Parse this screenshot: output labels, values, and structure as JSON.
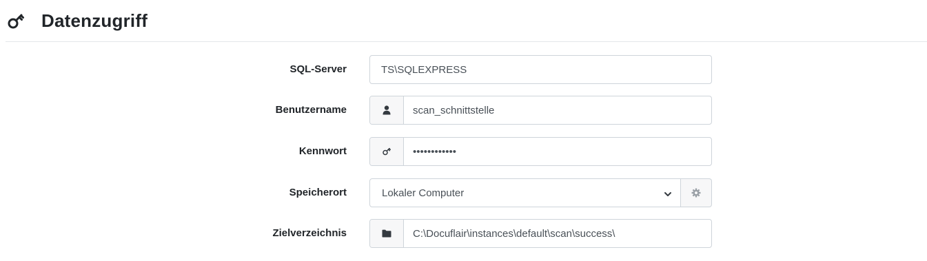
{
  "header": {
    "title": "Datenzugriff",
    "icon": "key-icon"
  },
  "form": {
    "sql_server": {
      "label": "SQL-Server",
      "value": "TS\\SQLEXPRESS"
    },
    "username": {
      "label": "Benutzername",
      "icon": "user-icon",
      "value": "scan_schnittstelle"
    },
    "password": {
      "label": "Kennwort",
      "icon": "key-icon",
      "value": "••••••••••••"
    },
    "storage": {
      "label": "Speicherort",
      "selected": "Lokaler Computer",
      "settings_icon": "gear-icon"
    },
    "target_dir": {
      "label": "Zielverzeichnis",
      "icon": "folder-icon",
      "value": "C:\\Docuflair\\instances\\default\\scan\\success\\"
    }
  },
  "colors": {
    "text": "#212529",
    "input_text": "#495057",
    "border": "#ced4da",
    "addon_bg": "#f7f7f8",
    "icon": "#343a40",
    "icon_muted": "#9aa0a6"
  }
}
